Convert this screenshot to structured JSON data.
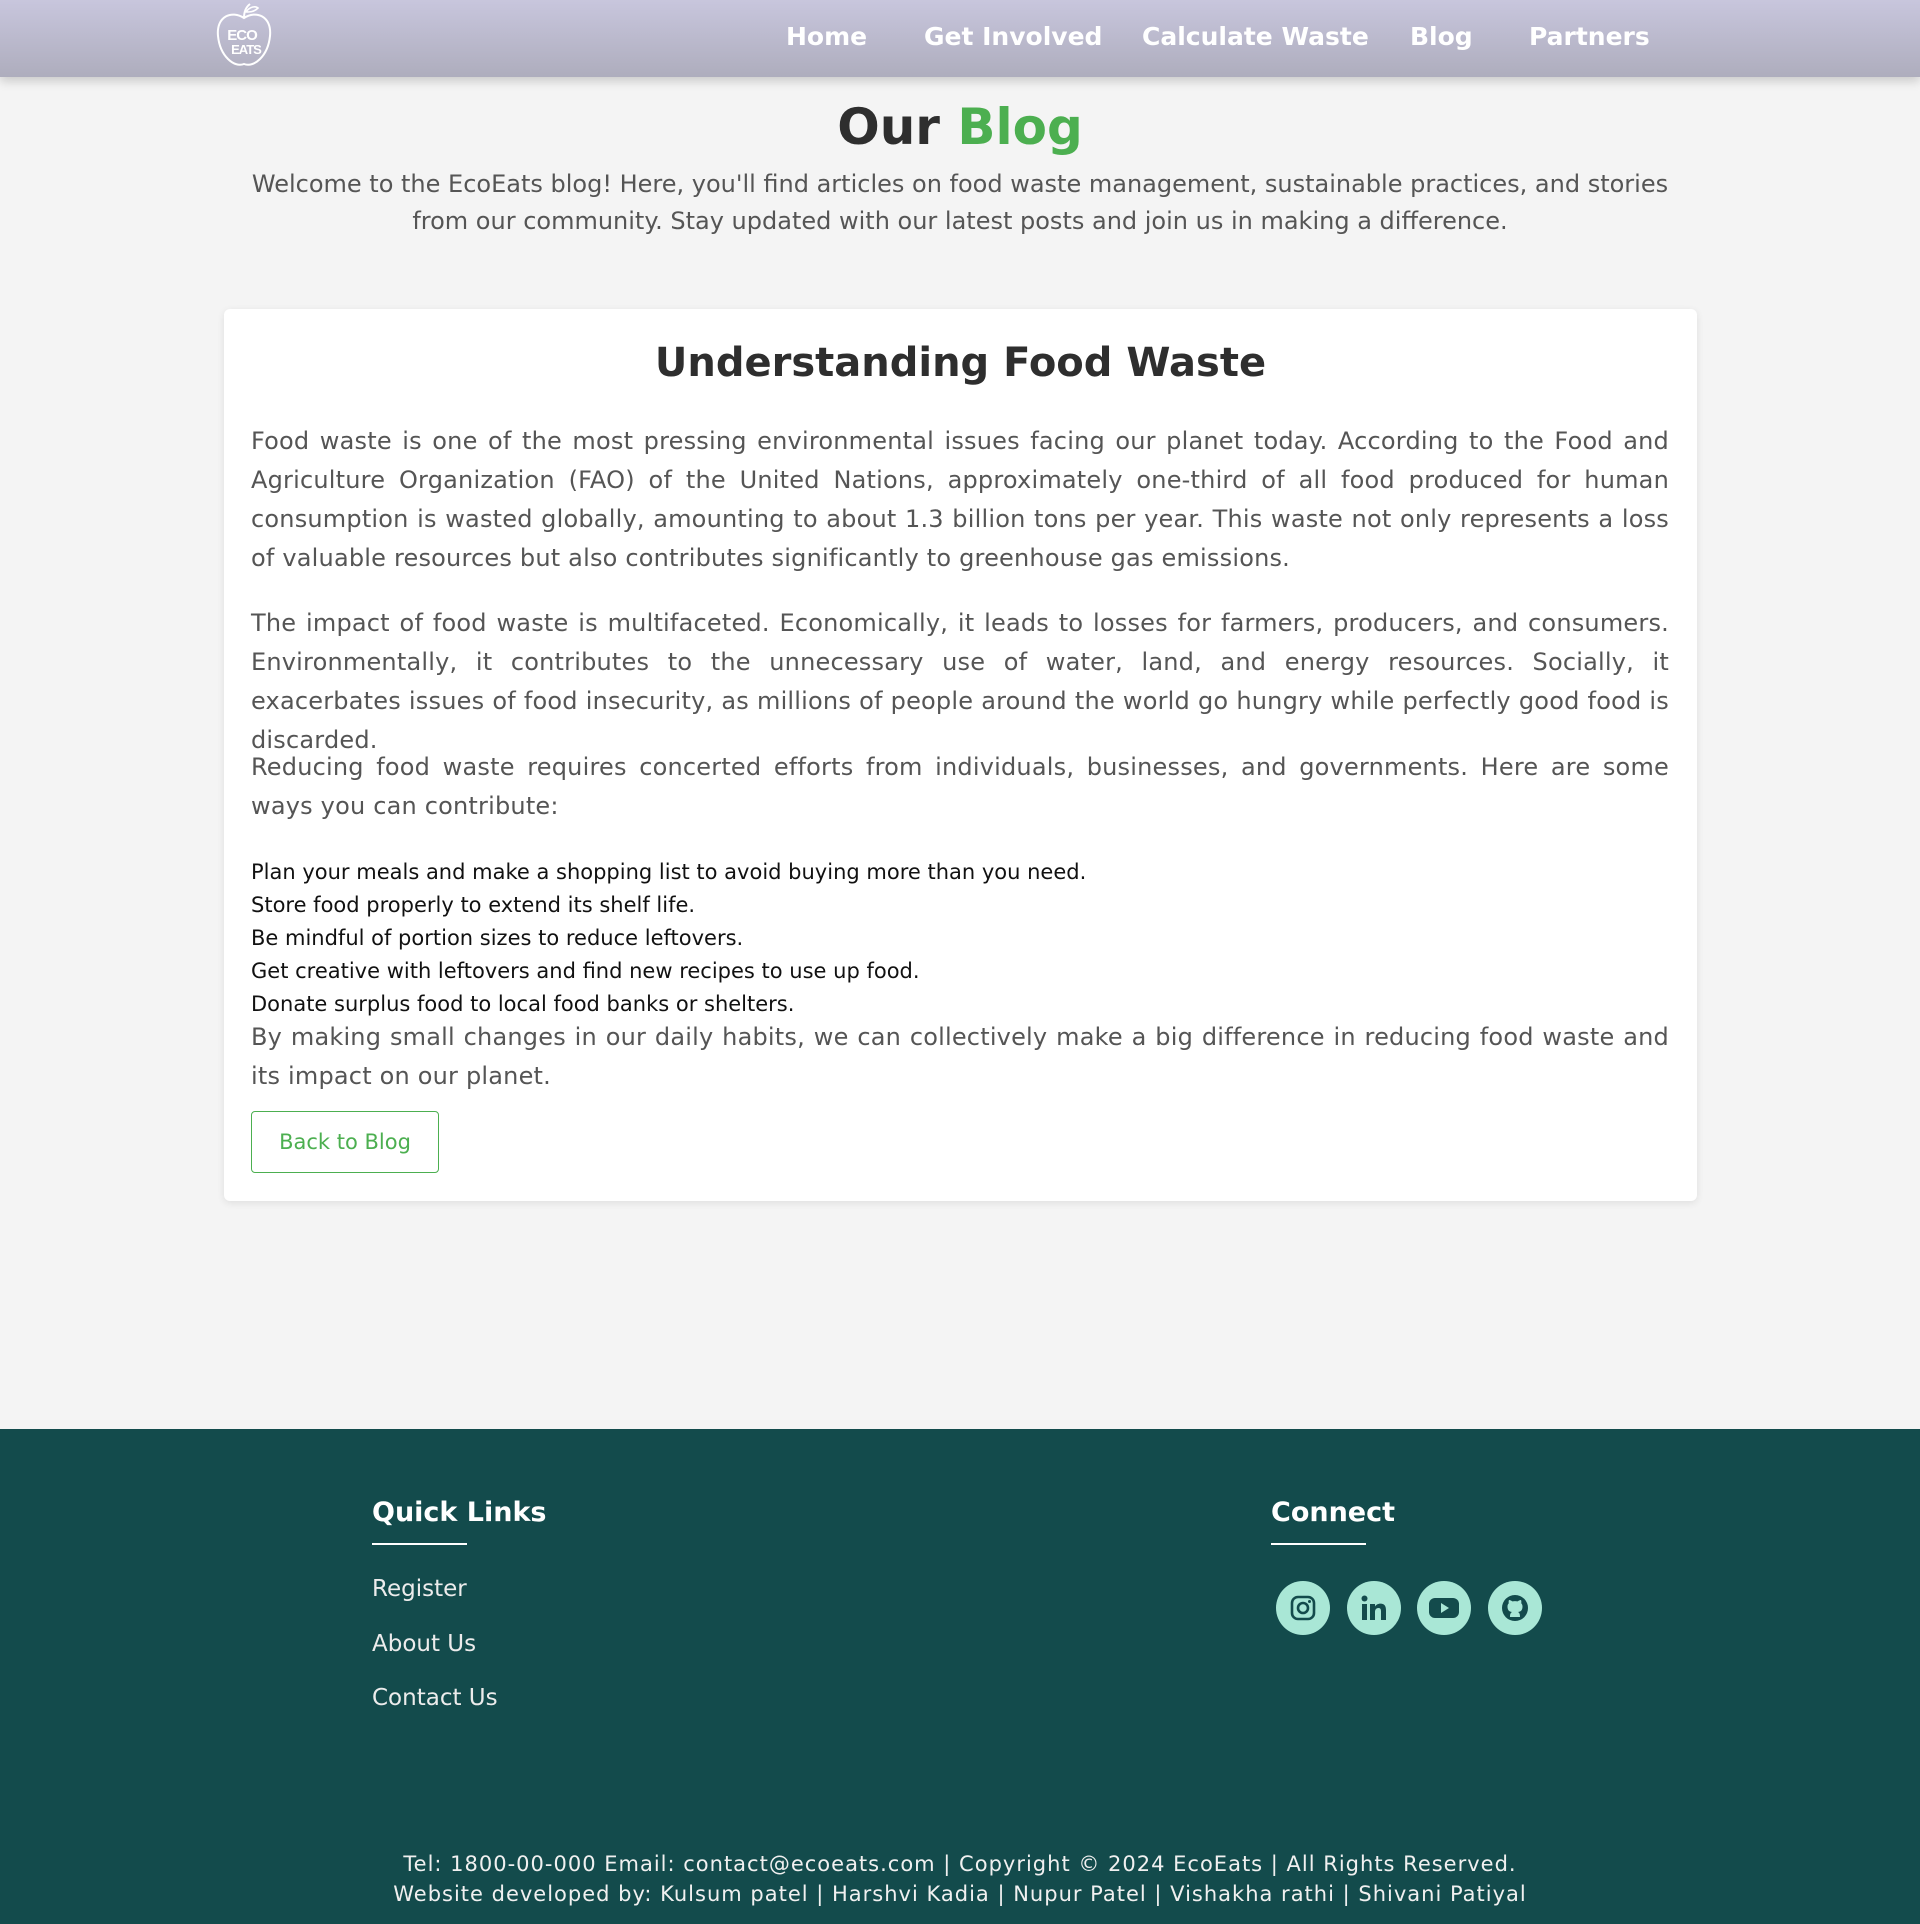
{
  "nav": {
    "logo_text": "ECO EATS",
    "links": [
      "Home",
      "Get Involved",
      "Calculate Waste",
      "Blog",
      "Partners"
    ]
  },
  "hero": {
    "title_main": "Our",
    "title_accent": "Blog",
    "intro": "Welcome to the EcoEats blog! Here, you'll find articles on food waste management, sustainable practices, and stories from our community. Stay updated with our latest posts and join us in making a difference."
  },
  "article": {
    "title": "Understanding Food Waste",
    "paragraphs": [
      "Food waste is one of the most pressing environmental issues facing our planet today. According to the Food and Agriculture Organization (FAO) of the United Nations, approximately one-third of all food produced for human consumption is wasted globally, amounting to about 1.3 billion tons per year. This waste not only represents a loss of valuable resources but also contributes significantly to greenhouse gas emissions.",
      "The impact of food waste is multifaceted. Economically, it leads to losses for farmers, producers, and consumers. Environmentally, it contributes to the unnecessary use of water, land, and energy resources. Socially, it exacerbates issues of food insecurity, as millions of people around the world go hungry while perfectly good food is discarded.",
      "Reducing food waste requires concerted efforts from individuals, businesses, and governments. Here are some ways you can contribute:"
    ],
    "tips": [
      "Plan your meals and make a shopping list to avoid buying more than you need.",
      "Store food properly to extend its shelf life.",
      "Be mindful of portion sizes to reduce leftovers.",
      "Get creative with leftovers and find new recipes to use up food.",
      "Donate surplus food to local food banks or shelters."
    ],
    "closing": "By making small changes in our daily habits, we can collectively make a big difference in reducing food waste and its impact on our planet.",
    "back_button": "Back to Blog"
  },
  "footer": {
    "quick_links_heading": "Quick Links",
    "quick_links": [
      "Register",
      "About Us",
      "Contact Us"
    ],
    "connect_heading": "Connect",
    "social_icons": [
      "instagram-icon",
      "linkedin-icon",
      "youtube-icon",
      "github-icon"
    ],
    "contact_line": "Tel: 1800-00-000 Email: contact@ecoeats.com | Copyright © 2024 EcoEats | All Rights Reserved.",
    "credits_line": "Website developed by: Kulsum patel | Harshvi Kadia | Nupur Patel | Vishakha rathi | Shivani Patiyal"
  },
  "colors": {
    "accent": "#4caf50",
    "footer_bg": "#134b4c",
    "social_bg": "#a9e7d6",
    "header_top": "#c8c6dd",
    "header_bottom": "#aeadbd"
  }
}
